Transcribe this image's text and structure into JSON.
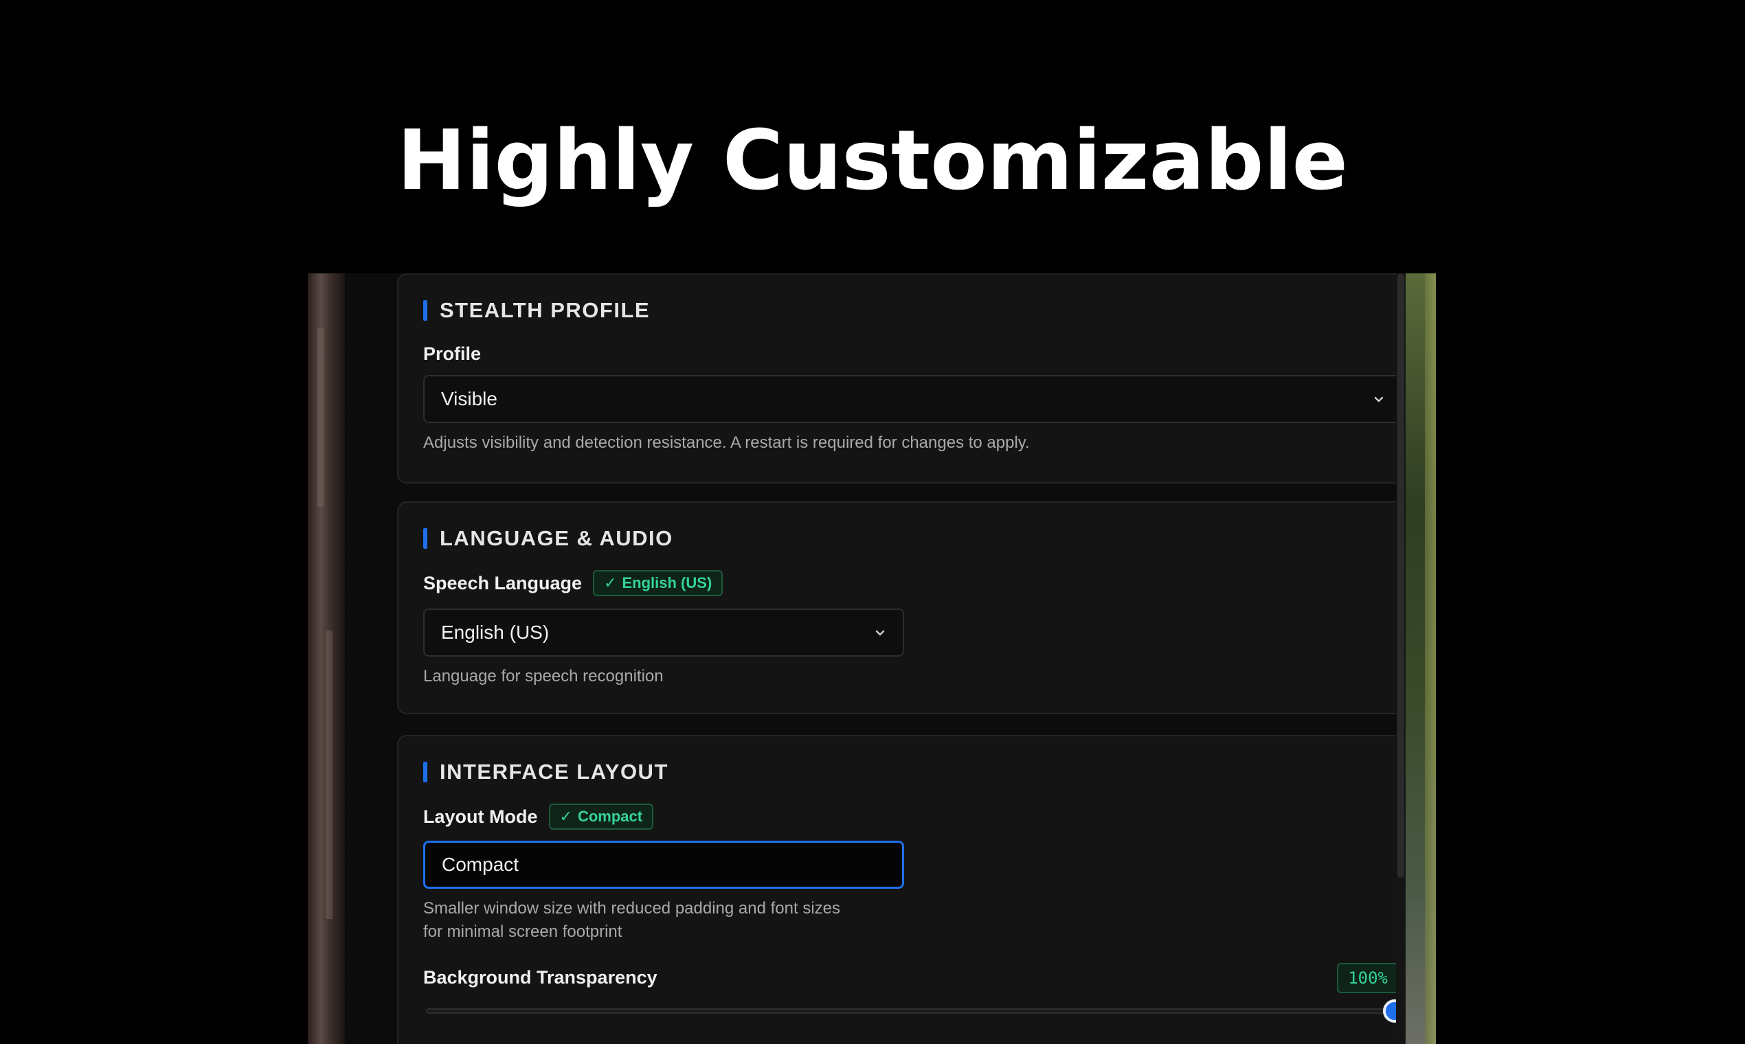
{
  "hero": {
    "title": "Highly Customizable"
  },
  "stealth": {
    "title": "STEALTH PROFILE",
    "profile_label": "Profile",
    "profile_value": "Visible",
    "help": "Adjusts visibility and detection resistance. A restart is required for changes to apply."
  },
  "language": {
    "title": "LANGUAGE & AUDIO",
    "speech_label": "Speech Language",
    "badge_check": "✓",
    "badge_text": "English (US)",
    "select_value": "English (US)",
    "help": "Language for speech recognition"
  },
  "layout": {
    "title": "INTERFACE LAYOUT",
    "mode_label": "Layout Mode",
    "badge_check": "✓",
    "badge_text": "Compact",
    "mode_value": "Compact",
    "help_line1": "Smaller window size with reduced padding and font sizes",
    "help_line2": "for minimal screen footprint",
    "transparency_label": "Background Transparency",
    "transparency_value": "100%",
    "transparency_level": 1.0
  },
  "colors": {
    "accent": "#1f6feb",
    "success": "#34d399",
    "card_bg": "#141414",
    "page_bg": "#000000"
  },
  "icons": {
    "chevron": "chevron-down-icon",
    "check": "check-icon"
  }
}
